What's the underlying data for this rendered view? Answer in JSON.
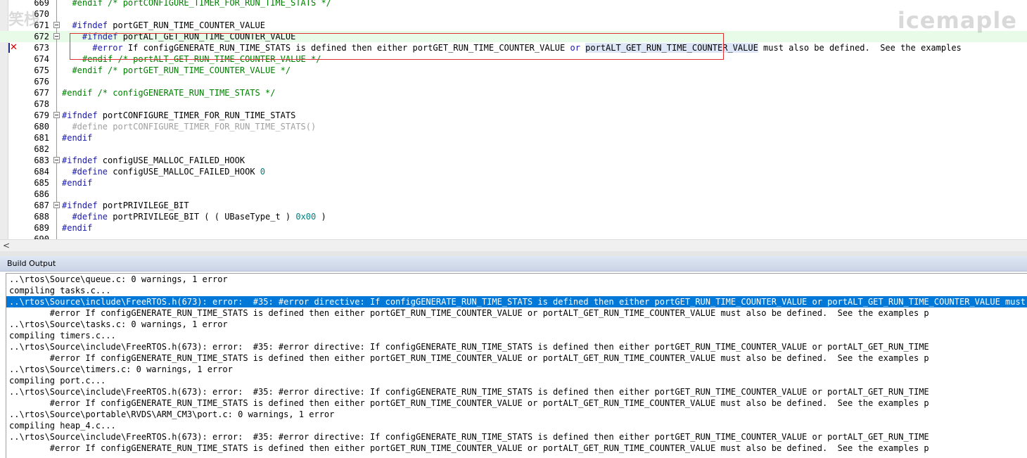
{
  "watermark_left": "笑栈",
  "watermark_right": "icemaple",
  "editor": {
    "lines": [
      {
        "n": "669",
        "fold": "line",
        "parts": [
          {
            "c": "cm",
            "t": "  #endif /* portCONFIGURE_TIMER_FOR_RUN_TIME_STATS */"
          }
        ]
      },
      {
        "n": "670",
        "fold": "line",
        "parts": []
      },
      {
        "n": "671",
        "fold": "box",
        "parts": [
          {
            "c": "pp",
            "t": "  #ifndef "
          },
          {
            "c": "tx",
            "t": "portGET_RUN_TIME_COUNTER_VALUE"
          }
        ]
      },
      {
        "n": "672",
        "fold": "box",
        "cur": true,
        "parts": [
          {
            "c": "pp",
            "t": "    #ifndef "
          },
          {
            "c": "tx",
            "t": "portALT_GET_RUN_TIME_COUNTER_VALUE"
          }
        ]
      },
      {
        "n": "673",
        "fold": "line",
        "parts": [
          {
            "c": "pp",
            "t": "      #error"
          },
          {
            "c": "tx",
            "t": " If configGENERATE_RUN_TIME_STATS is defined then either portGET_RUN_TIME_COUNTER_VALUE "
          },
          {
            "c": "kw",
            "t": "or"
          },
          {
            "c": "tx",
            "t": " "
          },
          {
            "c": "hl",
            "t": "portALT_GET_RUN_TIME_COUNTER_VALUE"
          },
          {
            "c": "tx",
            "t": " must also be defined.  See the examples"
          }
        ]
      },
      {
        "n": "674",
        "fold": "line",
        "parts": [
          {
            "c": "cm",
            "t": "    #endif /* portALT_GET_RUN_TIME_COUNTER_VALUE */"
          }
        ]
      },
      {
        "n": "675",
        "fold": "line",
        "parts": [
          {
            "c": "cm",
            "t": "  #endif /* portGET_RUN_TIME_COUNTER_VALUE */"
          }
        ]
      },
      {
        "n": "676",
        "fold": "line",
        "parts": []
      },
      {
        "n": "677",
        "fold": "line",
        "parts": [
          {
            "c": "cm",
            "t": "#endif /* configGENERATE_RUN_TIME_STATS */"
          }
        ]
      },
      {
        "n": "678",
        "fold": "line",
        "parts": []
      },
      {
        "n": "679",
        "fold": "box",
        "parts": [
          {
            "c": "pp",
            "t": "#ifndef "
          },
          {
            "c": "tx",
            "t": "portCONFIGURE_TIMER_FOR_RUN_TIME_STATS"
          }
        ]
      },
      {
        "n": "680",
        "fold": "line",
        "parts": [
          {
            "c": "gr",
            "t": "  #define portCONFIGURE_TIMER_FOR_RUN_TIME_STATS()"
          }
        ]
      },
      {
        "n": "681",
        "fold": "line",
        "parts": [
          {
            "c": "pp",
            "t": "#endif"
          }
        ]
      },
      {
        "n": "682",
        "fold": "line",
        "parts": []
      },
      {
        "n": "683",
        "fold": "box",
        "parts": [
          {
            "c": "pp",
            "t": "#ifndef "
          },
          {
            "c": "tx",
            "t": "configUSE_MALLOC_FAILED_HOOK"
          }
        ]
      },
      {
        "n": "684",
        "fold": "line",
        "parts": [
          {
            "c": "pp",
            "t": "  #define "
          },
          {
            "c": "tx",
            "t": "configUSE_MALLOC_FAILED_HOOK "
          },
          {
            "c": "num",
            "t": "0"
          }
        ]
      },
      {
        "n": "685",
        "fold": "line",
        "parts": [
          {
            "c": "pp",
            "t": "#endif"
          }
        ]
      },
      {
        "n": "686",
        "fold": "line",
        "parts": []
      },
      {
        "n": "687",
        "fold": "box",
        "parts": [
          {
            "c": "pp",
            "t": "#ifndef "
          },
          {
            "c": "tx",
            "t": "portPRIVILEGE_BIT"
          }
        ]
      },
      {
        "n": "688",
        "fold": "line",
        "parts": [
          {
            "c": "pp",
            "t": "  #define "
          },
          {
            "c": "tx",
            "t": "portPRIVILEGE_BIT ( ( UBaseType_t ) "
          },
          {
            "c": "num",
            "t": "0x00"
          },
          {
            "c": "tx",
            "t": " )"
          }
        ]
      },
      {
        "n": "689",
        "fold": "line",
        "parts": [
          {
            "c": "pp",
            "t": "#endif"
          }
        ]
      },
      {
        "n": "690",
        "fold": "line",
        "parts": []
      }
    ]
  },
  "build": {
    "title": "Build Output",
    "lines": [
      {
        "t": "..\\rtos\\Source\\queue.c: 0 warnings, 1 error"
      },
      {
        "t": "compiling tasks.c..."
      },
      {
        "t": "..\\rtos\\Source\\include\\FreeRTOS.h(673): error:  #35: #error directive: If configGENERATE_RUN_TIME_STATS is defined then either portGET_RUN_TIME_COUNTER_VALUE or portALT_GET_RUN_TIME_COUNTER_VALUE must also be defined.",
        "sel": true
      },
      {
        "t": "        #error If configGENERATE_RUN_TIME_STATS is defined then either portGET_RUN_TIME_COUNTER_VALUE or portALT_GET_RUN_TIME_COUNTER_VALUE must also be defined.  See the examples p"
      },
      {
        "t": "..\\rtos\\Source\\tasks.c: 0 warnings, 1 error"
      },
      {
        "t": "compiling timers.c..."
      },
      {
        "t": "..\\rtos\\Source\\include\\FreeRTOS.h(673): error:  #35: #error directive: If configGENERATE_RUN_TIME_STATS is defined then either portGET_RUN_TIME_COUNTER_VALUE or portALT_GET_RUN_TIME"
      },
      {
        "t": "        #error If configGENERATE_RUN_TIME_STATS is defined then either portGET_RUN_TIME_COUNTER_VALUE or portALT_GET_RUN_TIME_COUNTER_VALUE must also be defined.  See the examples p"
      },
      {
        "t": "..\\rtos\\Source\\timers.c: 0 warnings, 1 error"
      },
      {
        "t": "compiling port.c..."
      },
      {
        "t": "..\\rtos\\Source\\include\\FreeRTOS.h(673): error:  #35: #error directive: If configGENERATE_RUN_TIME_STATS is defined then either portGET_RUN_TIME_COUNTER_VALUE or portALT_GET_RUN_TIME"
      },
      {
        "t": "        #error If configGENERATE_RUN_TIME_STATS is defined then either portGET_RUN_TIME_COUNTER_VALUE or portALT_GET_RUN_TIME_COUNTER_VALUE must also be defined.  See the examples p"
      },
      {
        "t": "..\\rtos\\Source\\portable\\RVDS\\ARM_CM3\\port.c: 0 warnings, 1 error"
      },
      {
        "t": "compiling heap_4.c..."
      },
      {
        "t": "..\\rtos\\Source\\include\\FreeRTOS.h(673): error:  #35: #error directive: If configGENERATE_RUN_TIME_STATS is defined then either portGET_RUN_TIME_COUNTER_VALUE or portALT_GET_RUN_TIME"
      },
      {
        "t": "        #error If configGENERATE_RUN_TIME_STATS is defined then either portGET_RUN_TIME_COUNTER_VALUE or portALT_GET_RUN_TIME_COUNTER_VALUE must also be defined.  See the examples p"
      }
    ]
  },
  "icons": {
    "error_marker": "x-mark-icon",
    "scroll_left": "chevron-left-icon"
  },
  "glyphs": {
    "error_marker": "✕",
    "scroll_left": "<"
  }
}
